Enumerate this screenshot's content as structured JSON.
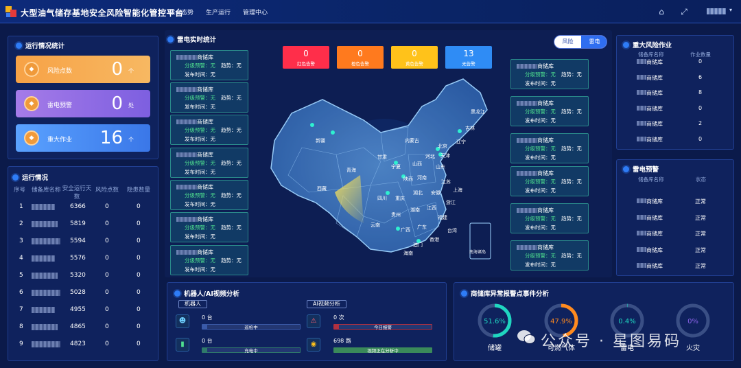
{
  "header": {
    "title": "大型油气储存基地安全风险智能化管控平台",
    "nav": [
      "综合态势",
      "生产运行",
      "管理中心"
    ],
    "icons": [
      "home-icon",
      "fullscreen-icon",
      "user-avatar"
    ]
  },
  "ops_stats": {
    "title": "运行情况统计",
    "cards": [
      {
        "label": "风险点数",
        "value": "0",
        "unit": "个",
        "color": "#f7a246"
      },
      {
        "label": "雷电预警",
        "value": "0",
        "unit": "处",
        "color": "#8a63e8"
      },
      {
        "label": "重大作业",
        "value": "16",
        "unit": "个",
        "color": "#4b8cf0"
      }
    ]
  },
  "ops_table": {
    "title": "运行情况",
    "headers": [
      "序号",
      "储备库名称",
      "安全运行天数",
      "风险点数",
      "隐患数量"
    ],
    "rows": [
      {
        "idx": "1",
        "days": "6366",
        "risk": "0",
        "hazard": "0"
      },
      {
        "idx": "2",
        "days": "5819",
        "risk": "0",
        "hazard": "0"
      },
      {
        "idx": "3",
        "days": "5594",
        "risk": "0",
        "hazard": "0"
      },
      {
        "idx": "4",
        "days": "5576",
        "risk": "0",
        "hazard": "0"
      },
      {
        "idx": "5",
        "days": "5320",
        "risk": "0",
        "hazard": "0"
      },
      {
        "idx": "6",
        "days": "5028",
        "risk": "0",
        "hazard": "0"
      },
      {
        "idx": "7",
        "days": "4955",
        "risk": "0",
        "hazard": "0"
      },
      {
        "idx": "8",
        "days": "4865",
        "risk": "0",
        "hazard": "0"
      },
      {
        "idx": "9",
        "days": "4823",
        "risk": "0",
        "hazard": "0"
      }
    ]
  },
  "lightning": {
    "title": "雷电实时统计",
    "toggle": [
      "风险",
      "雷电"
    ],
    "alerts": [
      {
        "value": "0",
        "label": "红色告警",
        "color": "#ff2e4a"
      },
      {
        "value": "0",
        "label": "橙色告警",
        "color": "#ff7a1e"
      },
      {
        "value": "0",
        "label": "黄色告警",
        "color": "#ffc21a"
      },
      {
        "value": "13",
        "label": "无告警",
        "color": "#2f8cf5"
      }
    ],
    "box_name_suffix": "商储库",
    "box_line1": "分级预警：无",
    "box_trend": "趋势：无",
    "box_line2": "发布时间：无",
    "map_labels": [
      "新疆",
      "西藏",
      "青海",
      "甘肃",
      "内蒙古",
      "黑龙江",
      "吉林",
      "辽宁",
      "北京",
      "天津",
      "河北",
      "山西",
      "山东",
      "宁夏",
      "陕西",
      "河南",
      "江苏",
      "上海",
      "安徽",
      "浙江",
      "四川",
      "重庆",
      "湖北",
      "湖南",
      "江西",
      "福建",
      "贵州",
      "云南",
      "广西",
      "广东",
      "台湾",
      "香港",
      "澳门",
      "海南",
      "南海诸岛"
    ]
  },
  "major_ops": {
    "title": "重大风险作业",
    "headers": [
      "储备库名称",
      "作业数量"
    ],
    "rows": [
      {
        "name": "商储库",
        "count": "0"
      },
      {
        "name": "商储库",
        "count": "6"
      },
      {
        "name": "商储库",
        "count": "8"
      },
      {
        "name": "商储库",
        "count": "0"
      },
      {
        "name": "商储库",
        "count": "2"
      },
      {
        "name": "商储库",
        "count": "0"
      }
    ]
  },
  "lightning_warn": {
    "title": "雷电预警",
    "headers": [
      "储备库名称",
      "状态"
    ],
    "rows": [
      {
        "name": "商储库",
        "status": "正常"
      },
      {
        "name": "商储库",
        "status": "正常"
      },
      {
        "name": "商储库",
        "status": "正常"
      },
      {
        "name": "商储库",
        "status": "正常"
      },
      {
        "name": "商储库",
        "status": "正常"
      }
    ]
  },
  "robot": {
    "title": "机器人/AI视频分析",
    "tags": [
      "机器人",
      "AI视频分析"
    ],
    "items": [
      {
        "value": "0",
        "unit": "台",
        "bar": "巡检中",
        "color": "#3a5aa8",
        "fill": 0.05
      },
      {
        "value": "0",
        "unit": "次",
        "bar": "今日报警",
        "color": "#b03040",
        "fill": 0.05
      },
      {
        "value": "0",
        "unit": "台",
        "bar": "充电中",
        "color": "#2f7a6a",
        "fill": 0.05
      },
      {
        "value": "698",
        "unit": "路",
        "bar": "视频正在分析中",
        "color": "#3a8a5a",
        "fill": 1.0
      }
    ]
  },
  "anomaly": {
    "title": "商储库异常报警点事件分析",
    "gauges": [
      {
        "pct": "51.6%",
        "label": "储罐",
        "ratio": 0.516,
        "color": "#1fd6c0"
      },
      {
        "pct": "47.9%",
        "label": "可燃气体",
        "ratio": 0.479,
        "color": "#ff8a1e"
      },
      {
        "pct": "0.4%",
        "label": "雷电",
        "ratio": 0.004,
        "color": "#1fd6c0"
      },
      {
        "pct": "0%",
        "label": "火灾",
        "ratio": 0,
        "color": "#8a63e8"
      }
    ]
  },
  "watermark": "公众号 · 星图易码"
}
